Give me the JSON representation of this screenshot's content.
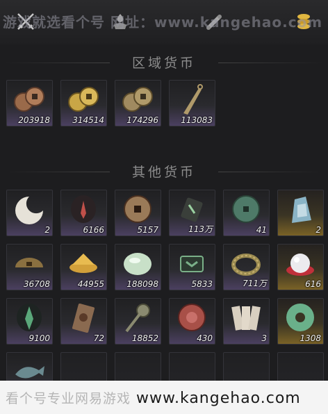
{
  "watermark_top": "游戏就选看个号 网址：www.kangehao.com",
  "footer": {
    "prefix": "看个号专业网易游戏",
    "domain": "www.kangehao.com"
  },
  "tabs": [
    {
      "icon": "crossed-swords-icon"
    },
    {
      "icon": "herb-icon"
    },
    {
      "icon": "scroll-icon"
    },
    {
      "icon": "coin-stack-icon",
      "active": true
    }
  ],
  "sections": {
    "regional": "区域货币",
    "other": "其他货币"
  },
  "regional_items": [
    {
      "icon": "copper-coins-icon",
      "count": "203918"
    },
    {
      "icon": "gold-coins-icon",
      "count": "314514"
    },
    {
      "icon": "bronze-coins-icon",
      "count": "174296"
    },
    {
      "icon": "knife-coin-icon",
      "count": "113083"
    }
  ],
  "other_items": [
    {
      "icon": "crescent-jade-icon",
      "count": "2",
      "rarity": "purple"
    },
    {
      "icon": "red-feather-token-icon",
      "count": "6166",
      "rarity": "purple"
    },
    {
      "icon": "ancient-coin-icon",
      "count": "5157",
      "rarity": "blue"
    },
    {
      "icon": "tag-token-icon",
      "count": "113万",
      "rarity": "blue"
    },
    {
      "icon": "green-jade-coin-icon",
      "count": "41",
      "rarity": "purple"
    },
    {
      "icon": "jade-stone-icon",
      "count": "2",
      "rarity": "gold"
    },
    {
      "icon": "bowl-coin-icon",
      "count": "36708",
      "rarity": "purple"
    },
    {
      "icon": "gold-dust-icon",
      "count": "44955",
      "rarity": "purple"
    },
    {
      "icon": "white-jade-icon",
      "count": "188098",
      "rarity": "purple"
    },
    {
      "icon": "jade-tablet-icon",
      "count": "5833",
      "rarity": "purple"
    },
    {
      "icon": "coin-string-icon",
      "count": "711万",
      "rarity": "purple"
    },
    {
      "icon": "pearl-icon",
      "count": "616",
      "rarity": "gold"
    },
    {
      "icon": "green-leaf-token-icon",
      "count": "9100",
      "rarity": "purple"
    },
    {
      "icon": "bronze-plaque-icon",
      "count": "72",
      "rarity": "purple"
    },
    {
      "icon": "coin-sword-icon",
      "count": "18852",
      "rarity": "purple"
    },
    {
      "icon": "red-seal-icon",
      "count": "430",
      "rarity": "purple"
    },
    {
      "icon": "paper-notes-icon",
      "count": "3",
      "rarity": "purple"
    },
    {
      "icon": "jade-bi-icon",
      "count": "1308",
      "rarity": "gold"
    },
    {
      "icon": "jade-fish-icon",
      "count": "",
      "rarity": "purple"
    },
    {
      "icon": "empty-slot",
      "count": "",
      "rarity": "empty"
    },
    {
      "icon": "empty-slot",
      "count": "",
      "rarity": "empty"
    },
    {
      "icon": "empty-slot",
      "count": "",
      "rarity": "empty"
    },
    {
      "icon": "empty-slot",
      "count": "",
      "rarity": "empty"
    },
    {
      "icon": "empty-slot",
      "count": "",
      "rarity": "empty"
    }
  ]
}
